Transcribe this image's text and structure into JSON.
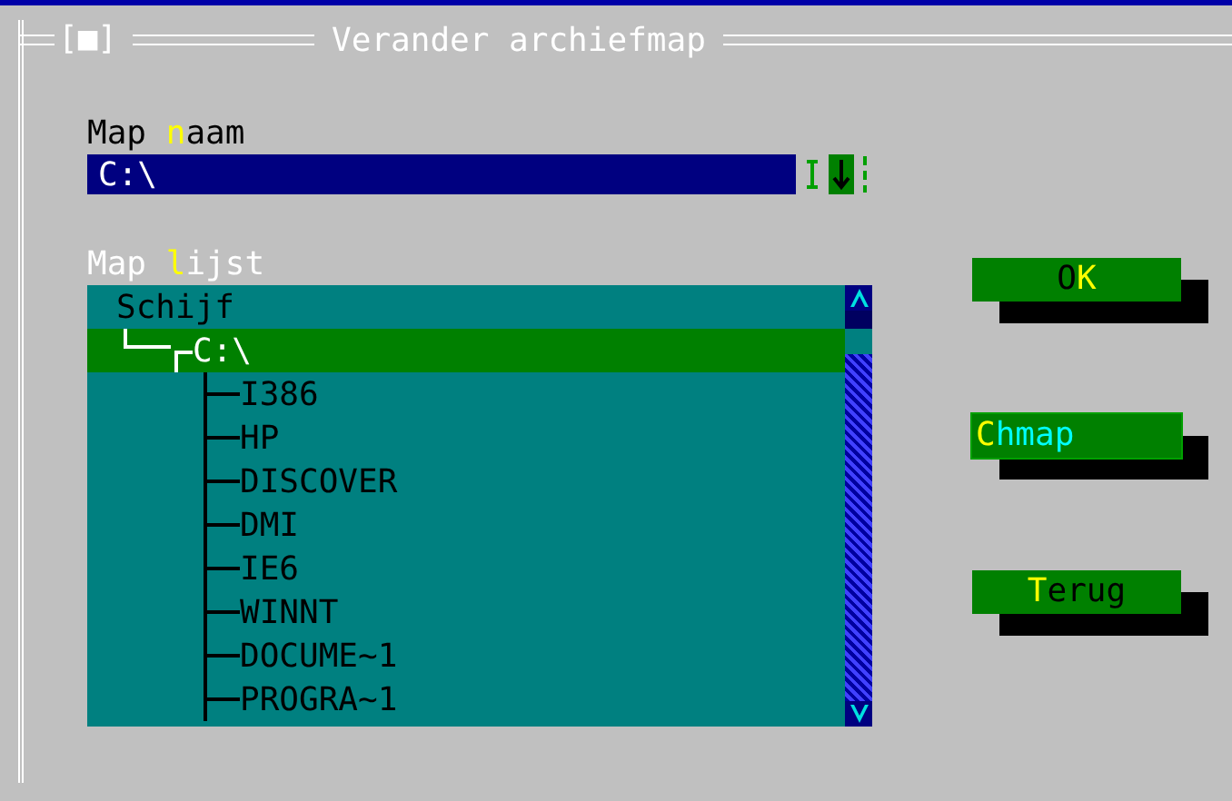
{
  "window": {
    "close_box": "[■]",
    "title": "Verander archiefmap"
  },
  "name_field": {
    "label": {
      "before": "Map ",
      "hotkey": "n",
      "after": "aam",
      "highlighted": false
    },
    "value": "C:\\"
  },
  "folder_list": {
    "label": {
      "before": "Map ",
      "hotkey": "l",
      "after": "ijst",
      "highlighted": true
    },
    "tree": [
      {
        "label": "Schijf",
        "selected": false,
        "children": [
          {
            "label": "C:\\",
            "selected": true,
            "children": [
              {
                "label": "I386",
                "selected": false
              },
              {
                "label": "HP",
                "selected": false
              },
              {
                "label": "DISCOVER",
                "selected": false
              },
              {
                "label": "DMI",
                "selected": false
              },
              {
                "label": "IE6",
                "selected": false
              },
              {
                "label": "WINNT",
                "selected": false
              },
              {
                "label": "DOCUME~1",
                "selected": false
              },
              {
                "label": "PROGRA~1",
                "selected": false
              }
            ]
          }
        ]
      }
    ]
  },
  "buttons": [
    {
      "before": "O",
      "hotkey": "K",
      "focused": false
    },
    {
      "hotkey": "C",
      "after": "hmap",
      "focused": true
    },
    {
      "hotkey": "T",
      "after": "erug",
      "focused": false
    }
  ]
}
